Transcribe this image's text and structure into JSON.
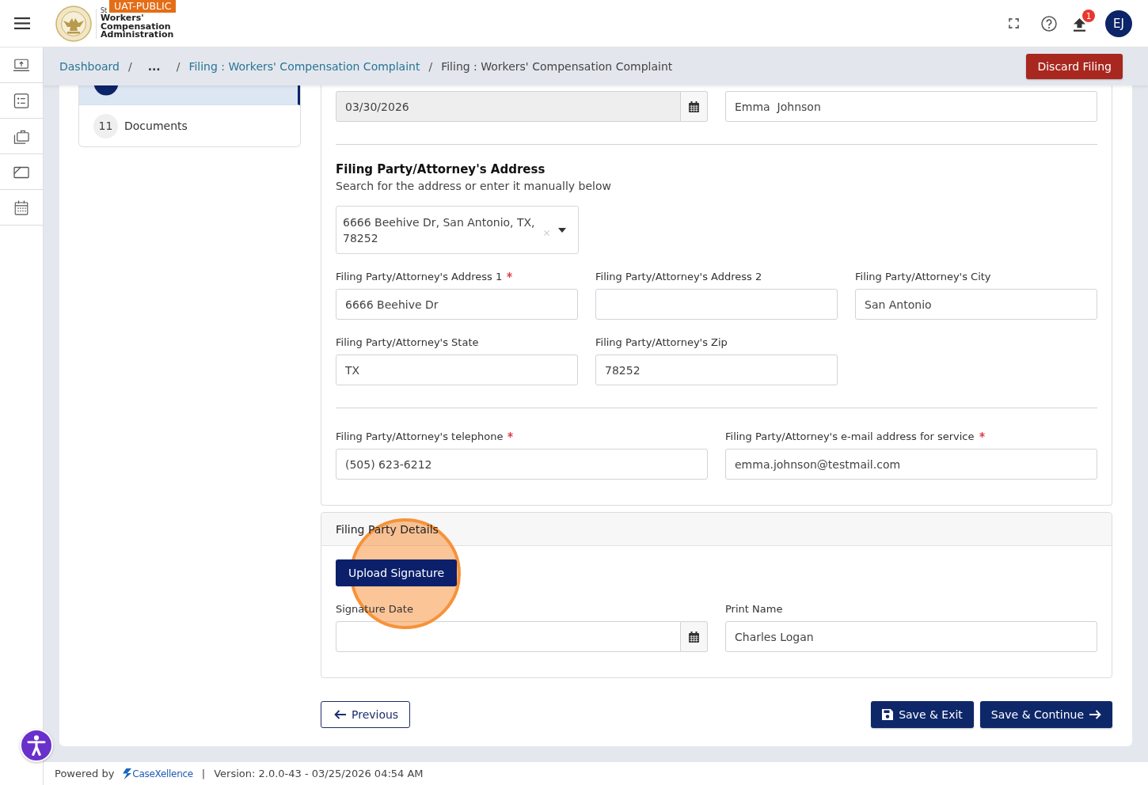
{
  "header": {
    "environment_badge": "UAT-PUBLIC",
    "logo_overline": "St",
    "logo_lines": [
      "Workers'",
      "Compensation",
      "Administration"
    ],
    "notification_count": "1",
    "avatar_initials": "EJ"
  },
  "breadcrumb": {
    "items": [
      {
        "kind": "link",
        "label": "Dashboard"
      },
      {
        "kind": "separator",
        "label": "/"
      },
      {
        "kind": "ellipsis",
        "label": "..."
      },
      {
        "kind": "separator",
        "label": "/"
      },
      {
        "kind": "link",
        "label": "Filing : Workers' Compensation Complaint"
      },
      {
        "kind": "separator",
        "label": "/"
      },
      {
        "kind": "current",
        "label": "Filing : Workers' Compensation Complaint"
      }
    ],
    "discard_button": "Discard Filing"
  },
  "steps": [
    {
      "kind": "partial",
      "selected": true
    },
    {
      "kind": "full",
      "number": "11",
      "label": "Documents",
      "selected": false
    }
  ],
  "top_fields": [
    {
      "kind": "date",
      "value": "03/30/2026",
      "disabled": true
    },
    {
      "kind": "text",
      "value": "Emma  Johnson",
      "disabled": false
    }
  ],
  "address": {
    "title": "Filing Party/Attorney's Address",
    "subtitle": "Search for the address or enter it manually below",
    "search_value": "6666 Beehive Dr, San Antonio, TX, 78252",
    "rows": [
      [
        {
          "kind": "text",
          "label": "Filing Party/Attorney's Address 1",
          "required": true,
          "value": "6666 Beehive Dr",
          "disabled": false
        },
        {
          "kind": "text",
          "label": "Filing Party/Attorney's Address 2",
          "required": false,
          "disabled": false
        },
        {
          "kind": "text",
          "label": "Filing Party/Attorney's City",
          "required": false,
          "value": "San Antonio",
          "disabled": false
        }
      ],
      [
        {
          "kind": "text",
          "label": "Filing Party/Attorney's State",
          "required": false,
          "value": "TX",
          "disabled": false
        },
        {
          "kind": "text",
          "label": "Filing Party/Attorney's Zip",
          "required": false,
          "value": "78252",
          "disabled": false
        }
      ]
    ]
  },
  "contact_fields": [
    {
      "kind": "text",
      "label": "Filing Party/Attorney's telephone",
      "required": true,
      "value": "(505) 623-6212",
      "disabled": false
    },
    {
      "kind": "text",
      "label": "Filing Party/Attorney's e-mail address for service",
      "required": true,
      "value": "emma.johnson@testmail.com",
      "disabled": false
    }
  ],
  "signature": {
    "title": "Filing Party Details",
    "upload_button": "Upload Signature",
    "fields": [
      {
        "kind": "date",
        "label": "Signature Date",
        "required": false,
        "disabled": false
      },
      {
        "kind": "text",
        "label": "Print Name",
        "required": false,
        "value": "Charles Logan",
        "disabled": false
      }
    ]
  },
  "actions": {
    "previous": "Previous",
    "save_exit": "Save & Exit",
    "save_continue": "Save & Continue"
  },
  "footer": {
    "powered_by": "Powered by",
    "brand": "CaseXellence",
    "separator": "|",
    "version": "Version: 2.0.0-43 - 03/25/2026 04:54 AM"
  }
}
